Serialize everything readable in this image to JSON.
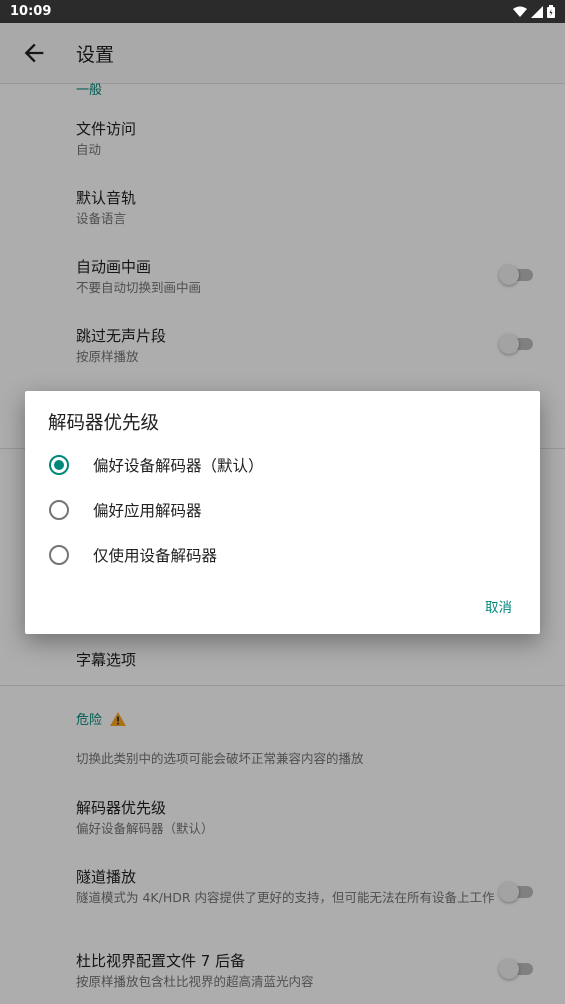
{
  "status_bar": {
    "time": "10:09"
  },
  "app_bar": {
    "title": "设置"
  },
  "settings": {
    "general_header": "一般",
    "file_access": {
      "title": "文件访问",
      "summary": "自动"
    },
    "default_audio": {
      "title": "默认音轨",
      "summary": "设备语言"
    },
    "auto_pip": {
      "title": "自动画中画",
      "summary": "不要自动切换到画中画"
    },
    "skip_silence": {
      "title": "跳过无声片段",
      "summary": "按原样播放"
    },
    "subtitle_options": {
      "title": "字幕选项"
    },
    "danger_header": "危险",
    "danger_description": "切换此类别中的选项可能会破坏正常兼容内容的播放",
    "decoder_priority": {
      "title": "解码器优先级",
      "summary": "偏好设备解码器（默认）"
    },
    "tunneling": {
      "title": "隧道播放",
      "summary": "隧道模式为 4K/HDR 内容提供了更好的支持，但可能无法在所有设备上工作"
    },
    "dolby_vision": {
      "title": "杜比视界配置文件 7 后备",
      "summary": "按原样播放包含杜比视界的超高清蓝光内容"
    }
  },
  "dialog": {
    "title": "解码器优先级",
    "options": [
      {
        "label": "偏好设备解码器（默认）",
        "selected": true
      },
      {
        "label": "偏好应用解码器",
        "selected": false
      },
      {
        "label": "仅使用设备解码器",
        "selected": false
      }
    ],
    "cancel_label": "取消"
  },
  "colors": {
    "accent": "#00897b",
    "status_bar": "#2b2b2b"
  }
}
